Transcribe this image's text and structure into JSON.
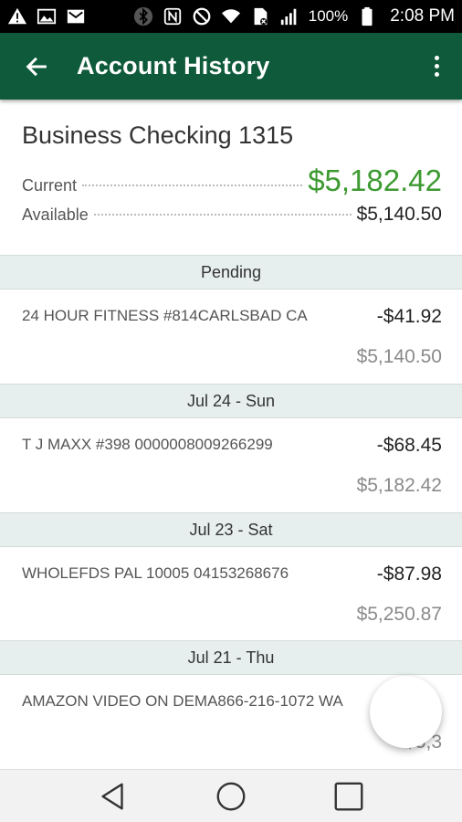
{
  "status_bar": {
    "icons": [
      "warning-icon",
      "image-icon",
      "mail-icon",
      "bluetooth-icon",
      "nfc-icon",
      "do-not-disturb-icon",
      "wifi-icon",
      "sim-icon",
      "signal-icon",
      "battery-icon"
    ],
    "battery": "100%",
    "time": "2:08 PM"
  },
  "app_bar": {
    "title": "Account History",
    "back_icon": "arrow-left-icon",
    "menu_icon": "more-vert-icon",
    "color": "#0e5a3a"
  },
  "account": {
    "name": "Business Checking 1315",
    "current_label": "Current",
    "current_value": "$5,182.42",
    "available_label": "Available",
    "available_value": "$5,140.50",
    "current_color": "#3d9a31"
  },
  "sections": [
    {
      "header": "Pending",
      "transactions": [
        {
          "description": "24 HOUR FITNESS #814CARLSBAD CA",
          "amount": "-$41.92",
          "balance": "$5,140.50"
        }
      ]
    },
    {
      "header": "Jul 24 - Sun",
      "transactions": [
        {
          "description": "T J MAXX #398 0000008009266299",
          "amount": "-$68.45",
          "balance": "$5,182.42"
        }
      ]
    },
    {
      "header": "Jul 23 - Sat",
      "transactions": [
        {
          "description": "WHOLEFDS PAL 10005 04153268676",
          "amount": "-$87.98",
          "balance": "$5,250.87"
        }
      ]
    },
    {
      "header": "Jul 21 - Thu",
      "transactions": [
        {
          "description": "AMAZON VIDEO ON DEMA866-216-1072 WA",
          "amount": "",
          "balance": "$5,3"
        }
      ]
    }
  ],
  "nav_bar": {
    "buttons": [
      "back-triangle-icon",
      "home-circle-icon",
      "recents-square-icon"
    ]
  }
}
